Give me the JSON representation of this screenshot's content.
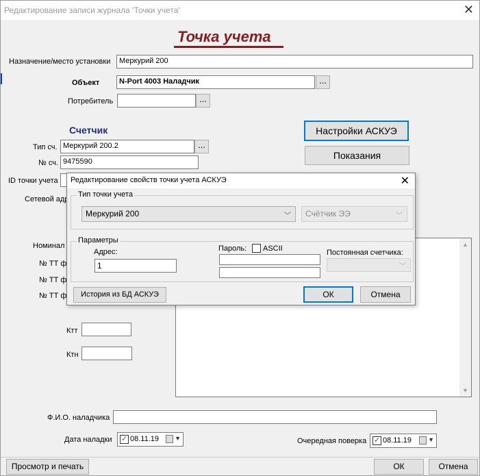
{
  "window": {
    "title": "Редактирование записи журнала 'Точки учета'"
  },
  "header": {
    "title": "Точка учета"
  },
  "form": {
    "purpose_label": "Назначение/место установки",
    "purpose_value": "Меркурий 200",
    "object_label": "Объект",
    "object_value": "N-Port 4003 Наладчик",
    "consumer_label": "Потребитель",
    "consumer_value": "",
    "dots": "...",
    "meter_section": "Счетчик",
    "meter_type_label": "Тип сч.",
    "meter_type_value": "Меркурий 200.2",
    "meter_no_label": "№ сч.",
    "meter_no_value": "9475590",
    "point_id_label": "ID точки учета",
    "net_addr_label": "Сетевой адр",
    "nominal_label": "Номинал",
    "tt_a_label": "№ ТТ ф",
    "tt_b_label": "№ ТТ ф",
    "tt_c_label": "№ ТТ ф",
    "ktt_label": "Ктт",
    "ktn_label": "Ктн",
    "askue_settings_button": "Настройки АСКУЭ",
    "readings_button": "Показания",
    "tuner_name_label": "Ф.И.О. наладчика",
    "tuner_name_value": "",
    "setup_date_label": "Дата наладки",
    "setup_date_value": "08.11.19",
    "next_check_label": "Очередная поверка",
    "next_check_value": "08.11.19"
  },
  "footer": {
    "preview_print_button": "Просмотр и печать",
    "ok_button": "ОК",
    "cancel_button": "Отмена"
  },
  "dialog": {
    "title": "Редактирование свойств точки учета АСКУЭ",
    "type_group": "Тип точки учета",
    "type_value": "Меркурий 200",
    "type2_value": "Счётчик ЭЭ",
    "params_group": "Параметры",
    "address_label": "Адрес:",
    "address_value": "1",
    "password_label": "Пароль:",
    "ascii_label": "ASCII",
    "const_label": "Постоянная счетчика:",
    "history_button": "История из БД АСКУЭ",
    "ok_button": "ОК",
    "cancel_button": "Отмена"
  }
}
